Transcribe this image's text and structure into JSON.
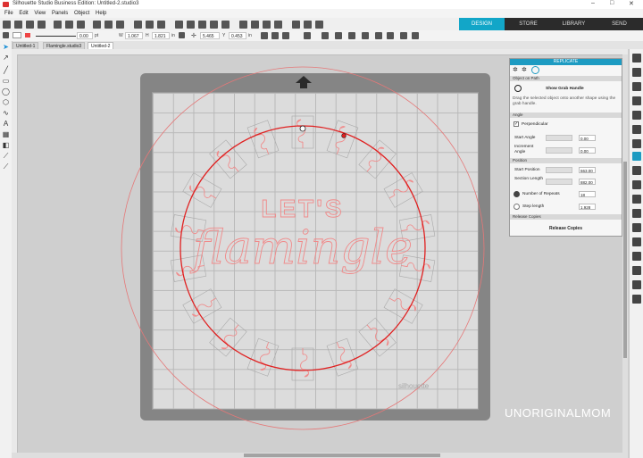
{
  "window": {
    "title": "Silhouette Studio Business Edition: Untitled-2.studio3"
  },
  "menu": [
    "File",
    "Edit",
    "View",
    "Panels",
    "Object",
    "Help"
  ],
  "nav_tabs": [
    {
      "label": "DESIGN",
      "active": true
    },
    {
      "label": "STORE",
      "active": false
    },
    {
      "label": "LIBRARY",
      "active": false
    },
    {
      "label": "SEND",
      "active": false
    }
  ],
  "toolbar2": {
    "line_width": "0.00",
    "line_unit": "pt",
    "w_label": "W",
    "w_value": "1.067",
    "h_label": "H",
    "h_value": "1.821",
    "size_unit": "in",
    "x_value": "5.465",
    "y_label": "Y",
    "y_value": "0.453",
    "pos_unit": "in"
  },
  "doc_tabs": [
    "Untitled-1",
    "Flamingle.studio3",
    "Untitled-2"
  ],
  "design": {
    "text_top": "LET'S",
    "text_script": "flamingle",
    "brand": "silhouette"
  },
  "panel": {
    "title": "REPLICATE",
    "section_path": "Object on Path",
    "show_grab_handle": "Show Grab Handle",
    "instructions": "Drag the selected object onto another shape using the grab handle.",
    "section_angle": "Angle",
    "perpendicular": "Perpendicular",
    "start_angle_label": "Start Angle",
    "start_angle_value": "0.00",
    "increment_angle_label": "Increment Angle",
    "increment_angle_value": "0.00",
    "section_position": "Position",
    "start_position_label": "Start Position",
    "start_position_value": "663.00",
    "section_length_label": "Section Length",
    "section_length_value": "882.00",
    "number_of_repeats_label": "Number of Repeats",
    "number_of_repeats_value": "18",
    "step_length_label": "Step length",
    "step_length_value": "1.928",
    "section_release": "Release Copies",
    "release_button": "Release Copies"
  },
  "watermark": "UNORIGINALMOM",
  "colors": {
    "accent": "#12a6c8",
    "design_line": "#f28b8b",
    "selection": "#e02020"
  },
  "icons": {
    "toolbar": [
      "new-icon",
      "open-icon",
      "save-icon",
      "print-icon",
      "cut-icon",
      "copy-icon",
      "paste-icon",
      "undo-icon",
      "redo-icon",
      "zoom-in-icon",
      "zoom-out-icon",
      "pan-icon",
      "group-icon",
      "ungroup-icon",
      "weld-icon",
      "replicate-icon"
    ],
    "left_tools": [
      "select-arrow-icon",
      "point-edit-icon",
      "line-icon",
      "rectangle-icon",
      "ellipse-icon",
      "polygon-icon",
      "text-icon",
      "fill-icon",
      "eraser-icon",
      "knife-icon",
      "eyedropper-icon"
    ],
    "right_panels": [
      "page-setup-icon",
      "library-icon",
      "color-icon",
      "line-style-icon",
      "fill-pattern-icon",
      "offset-icon",
      "text-style-icon",
      "replicate-icon",
      "transform-icon",
      "modify-icon",
      "layers-icon"
    ]
  }
}
